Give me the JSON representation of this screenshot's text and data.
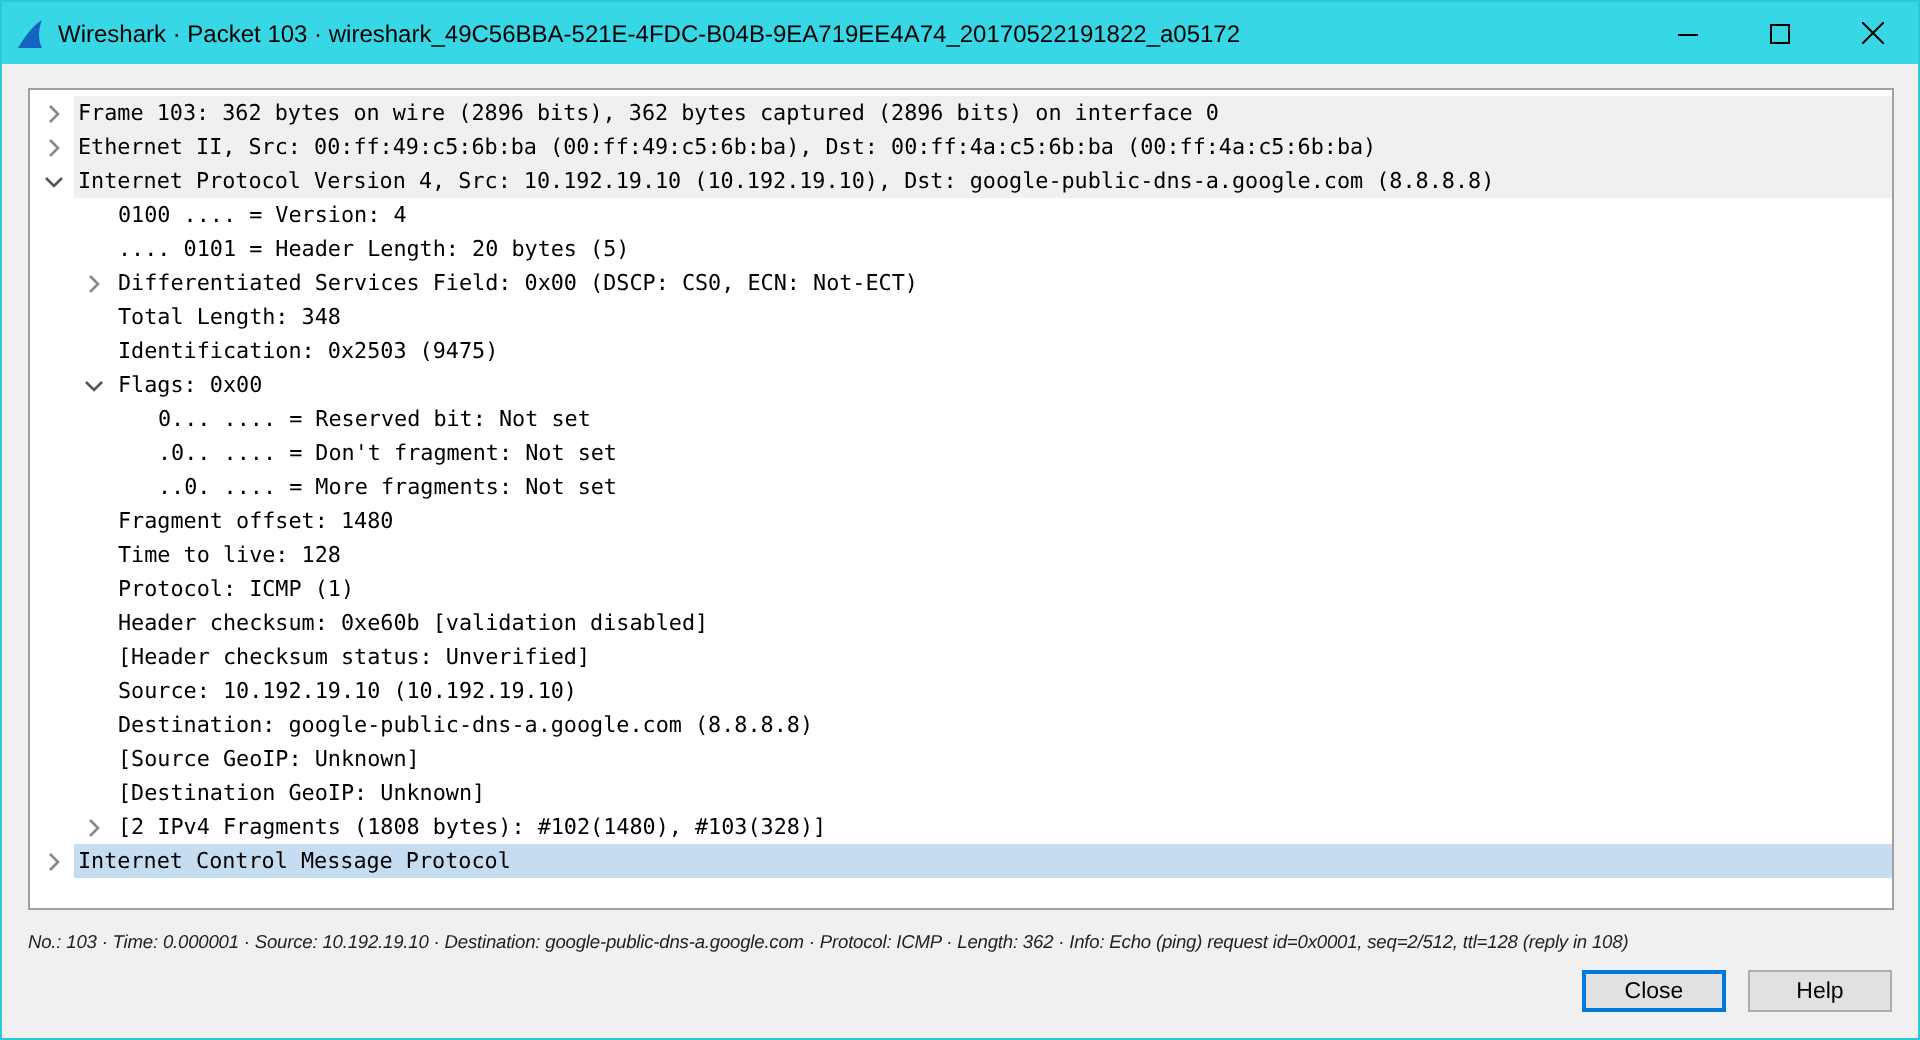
{
  "window": {
    "title": "Wireshark · Packet 103 · wireshark_49C56BBA-521E-4FDC-B04B-9EA719EE4A74_20170522191822_a05172"
  },
  "tree": [
    {
      "text": "Frame 103: 362 bytes on wire (2896 bits), 362 bytes captured (2896 bits) on interface 0",
      "expanded": false,
      "selected": false
    },
    {
      "text": "Ethernet II, Src: 00:ff:49:c5:6b:ba (00:ff:49:c5:6b:ba), Dst: 00:ff:4a:c5:6b:ba (00:ff:4a:c5:6b:ba)",
      "expanded": false,
      "selected": false
    },
    {
      "text": "Internet Protocol Version 4, Src: 10.192.19.10 (10.192.19.10), Dst: google-public-dns-a.google.com (8.8.8.8)",
      "expanded": true,
      "selected": false,
      "children": [
        {
          "text": "0100 .... = Version: 4",
          "selected": false
        },
        {
          "text": ".... 0101 = Header Length: 20 bytes (5)",
          "selected": false
        },
        {
          "text": "Differentiated Services Field: 0x00 (DSCP: CS0, ECN: Not-ECT)",
          "expanded": false,
          "selected": false
        },
        {
          "text": "Total Length: 348",
          "selected": false
        },
        {
          "text": "Identification: 0x2503 (9475)",
          "selected": false
        },
        {
          "text": "Flags: 0x00",
          "expanded": true,
          "selected": false,
          "children": [
            {
              "text": "0... .... = Reserved bit: Not set",
              "selected": false
            },
            {
              "text": ".0.. .... = Don't fragment: Not set",
              "selected": false
            },
            {
              "text": "..0. .... = More fragments: Not set",
              "selected": false
            }
          ]
        },
        {
          "text": "Fragment offset: 1480",
          "selected": false
        },
        {
          "text": "Time to live: 128",
          "selected": false
        },
        {
          "text": "Protocol: ICMP (1)",
          "selected": false
        },
        {
          "text": "Header checksum: 0xe60b [validation disabled]",
          "selected": false
        },
        {
          "text": "[Header checksum status: Unverified]",
          "selected": false
        },
        {
          "text": "Source: 10.192.19.10 (10.192.19.10)",
          "selected": false
        },
        {
          "text": "Destination: google-public-dns-a.google.com (8.8.8.8)",
          "selected": false
        },
        {
          "text": "[Source GeoIP: Unknown]",
          "selected": false
        },
        {
          "text": "[Destination GeoIP: Unknown]",
          "selected": false
        },
        {
          "text": "[2 IPv4 Fragments (1808 bytes): #102(1480), #103(328)]",
          "expanded": false,
          "selected": false
        }
      ]
    },
    {
      "text": "Internet Control Message Protocol",
      "expanded": false,
      "selected": true
    }
  ],
  "status": "No.: 103 · Time: 0.000001 · Source: 10.192.19.10 · Destination: google-public-dns-a.google.com · Protocol: ICMP · Length: 362 · Info: Echo (ping) request id=0x0001, seq=2/512, ttl=128 (reply in 108)",
  "buttons": [
    {
      "label": "Close",
      "default": true
    },
    {
      "label": "Help",
      "default": false
    }
  ]
}
